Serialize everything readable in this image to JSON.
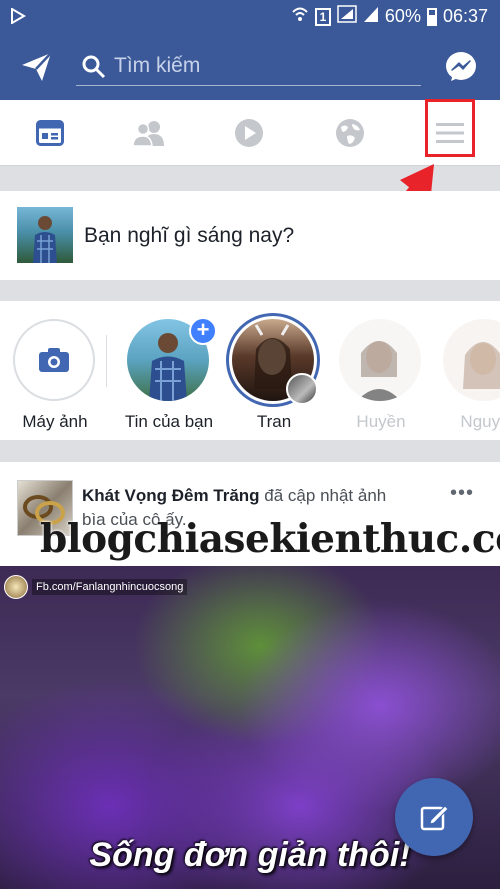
{
  "status_bar": {
    "battery_percent": "60%",
    "time": "06:37",
    "sim_label": "1"
  },
  "header": {
    "search_placeholder": "Tìm kiếm",
    "icons": [
      "send-icon",
      "search-icon",
      "messenger-icon"
    ]
  },
  "tabs": [
    {
      "name": "news-feed",
      "icon": "newsfeed-icon",
      "active": true
    },
    {
      "name": "friends",
      "icon": "friends-icon",
      "active": false
    },
    {
      "name": "watch",
      "icon": "play-icon",
      "active": false
    },
    {
      "name": "notifications",
      "icon": "globe-icon",
      "active": false
    },
    {
      "name": "menu",
      "icon": "hamburger-menu-icon",
      "active": false,
      "highlighted": true
    }
  ],
  "composer": {
    "prompt": "Bạn nghĩ gì sáng nay?"
  },
  "stories": [
    {
      "label": "Máy ảnh",
      "type": "camera"
    },
    {
      "label": "Tin của bạn",
      "type": "own"
    },
    {
      "label": "Tran",
      "type": "friend",
      "unseen": true
    },
    {
      "label": "Huyền",
      "type": "friend",
      "faded": true
    },
    {
      "label": "Nguye",
      "type": "friend",
      "faded": true
    }
  ],
  "post": {
    "author": "Khát Vọng Đêm Trăng",
    "action": " đã cập nhật ảnh bìa của cô ấy.",
    "more": "•••",
    "image_tag": "Fb.com/Fanlangnhincuocsong",
    "image_caption": "Sống đơn giản thôi!"
  },
  "watermark": "blogchiasekienthuc.com",
  "colors": {
    "facebook_blue": "#3b5998",
    "accent_blue": "#4267b2",
    "annotation_red": "#e8232a"
  }
}
